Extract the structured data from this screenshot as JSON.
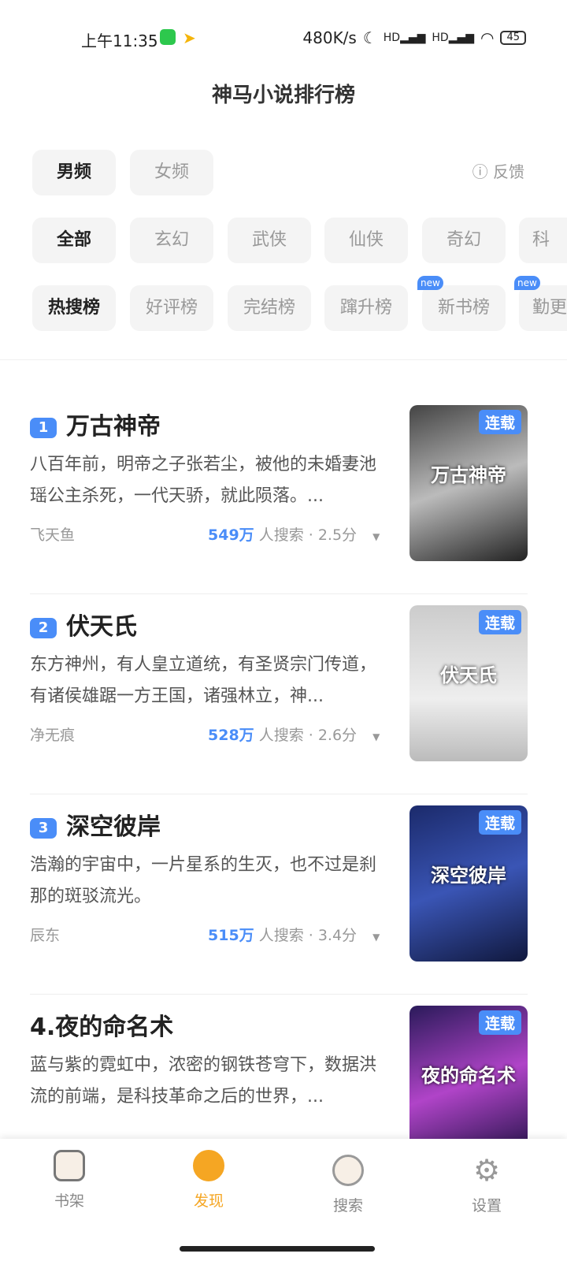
{
  "status": {
    "time": "上午11:35",
    "speed": "480K/s",
    "battery": "45"
  },
  "title": "神马小说排行榜",
  "gender_tabs": [
    {
      "label": "男频",
      "active": true
    },
    {
      "label": "女频",
      "active": false
    }
  ],
  "feedback": "反馈",
  "categories": [
    {
      "label": "全部",
      "active": true
    },
    {
      "label": "玄幻"
    },
    {
      "label": "武侠"
    },
    {
      "label": "仙侠"
    },
    {
      "label": "奇幻"
    },
    {
      "label": "科"
    }
  ],
  "rankings": [
    {
      "label": "热搜榜",
      "active": true
    },
    {
      "label": "好评榜"
    },
    {
      "label": "完结榜"
    },
    {
      "label": "蹿升榜"
    },
    {
      "label": "新书榜",
      "badge": "new"
    },
    {
      "label": "勤更",
      "badge": "new"
    }
  ],
  "books": [
    {
      "rank": "1",
      "title": "万古神帝",
      "desc": "八百年前，明帝之子张若尘，被他的未婚妻池瑶公主杀死，一代天骄，就此陨落。...",
      "author": "飞天鱼",
      "count": "549万",
      "suffix": "人搜索 · 2.5分",
      "tag": "连载",
      "cover_title": "万古神帝"
    },
    {
      "rank": "2",
      "title": "伏天氏",
      "desc": "东方神州，有人皇立道统，有圣贤宗门传道，有诸侯雄踞一方王国，诸强林立，神...",
      "author": "净无痕",
      "count": "528万",
      "suffix": "人搜索 · 2.6分",
      "tag": "连载",
      "cover_title": "伏天氏"
    },
    {
      "rank": "3",
      "title": "深空彼岸",
      "desc": "浩瀚的宇宙中，一片星系的生灭，也不过是刹那的斑驳流光。",
      "author": "辰东",
      "count": "515万",
      "suffix": "人搜索 · 3.4分",
      "tag": "连载",
      "cover_title": "深空彼岸"
    },
    {
      "rank": "",
      "title": "4.夜的命名术",
      "desc": "蓝与紫的霓虹中，浓密的钢铁苍穹下，数据洪流的前端，是科技革命之后的世界，...",
      "author": "",
      "count": "",
      "suffix": "",
      "tag": "连载",
      "cover_title": "夜的命名术"
    }
  ],
  "nav": [
    {
      "label": "书架"
    },
    {
      "label": "发现",
      "active": true
    },
    {
      "label": "搜索"
    },
    {
      "label": "设置"
    }
  ],
  "colors": {
    "accent": "#4a8df8",
    "nav_active": "#f5a623"
  }
}
